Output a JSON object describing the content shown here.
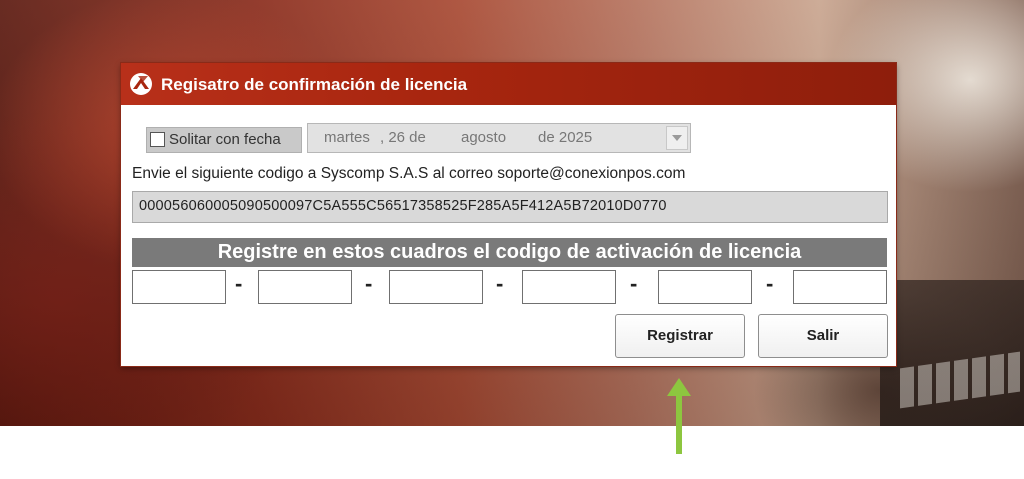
{
  "dialog": {
    "title": "Regisatro de confirmación de licencia",
    "logo_icon": "conexionpos-logo-icon",
    "date_checkbox": {
      "label": "Solitar con fecha",
      "checked": false
    },
    "date_picker": {
      "weekday": "martes",
      "day_part": ", 26 de",
      "month": "agosto",
      "year_part": "de 2025"
    },
    "instruction": "Envie el siguiente codigo a Syscomp S.A.S al correo soporte@conexionpos.com",
    "request_code": "000056060005090500097C5A555C56517358525F285A5F412A5B72010D0770",
    "banner": "Registre en estos cuadros el codigo de activación de licencia",
    "activation_fields": [
      "",
      "",
      "",
      "",
      "",
      ""
    ],
    "separator": "-",
    "register_button": "Registrar",
    "exit_button": "Salir"
  },
  "annotation": {
    "arrow_color": "#8dc63f",
    "icon": "arrow-up-icon"
  }
}
